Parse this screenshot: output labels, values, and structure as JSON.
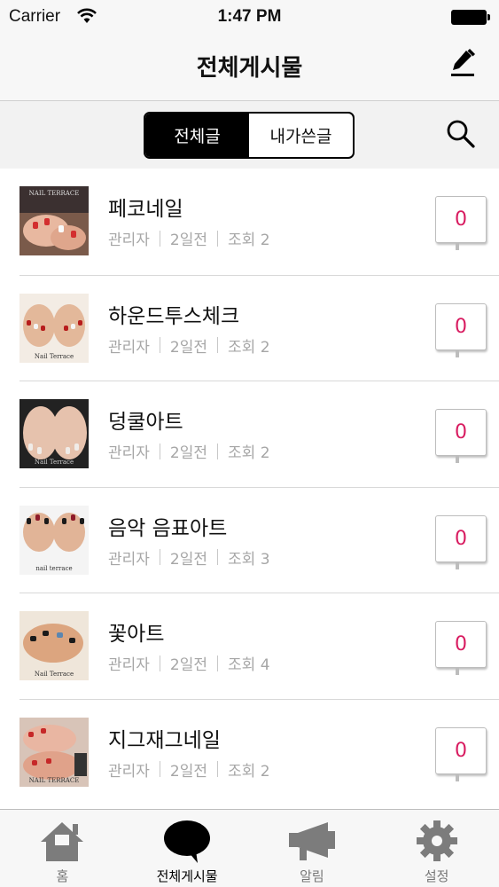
{
  "status_bar": {
    "carrier": "Carrier",
    "time": "1:47 PM"
  },
  "nav": {
    "title": "전체게시물",
    "edit_icon": "pencil-icon"
  },
  "segment": {
    "items": [
      "전체글",
      "내가쓴글"
    ],
    "selected": "전체글",
    "search_icon": "search-icon"
  },
  "posts": [
    {
      "title": "페코네일",
      "author": "관리자",
      "date": "2일전",
      "views": "조회 2",
      "comments": "0",
      "thumb_label": "NAIL TERRACE"
    },
    {
      "title": "하운드투스체크",
      "author": "관리자",
      "date": "2일전",
      "views": "조회 2",
      "comments": "0",
      "thumb_label": "Nail Terrace"
    },
    {
      "title": "덩쿨아트",
      "author": "관리자",
      "date": "2일전",
      "views": "조회 2",
      "comments": "0",
      "thumb_label": "Nail Terrace"
    },
    {
      "title": "음악 음표아트",
      "author": "관리자",
      "date": "2일전",
      "views": "조회 3",
      "comments": "0",
      "thumb_label": "nail terrace"
    },
    {
      "title": "꽃아트",
      "author": "관리자",
      "date": "2일전",
      "views": "조회 4",
      "comments": "0",
      "thumb_label": "Nail Terrace"
    },
    {
      "title": "지그재그네일",
      "author": "관리자",
      "date": "2일전",
      "views": "조회 2",
      "comments": "0",
      "thumb_label": "NAIL TERRACE"
    }
  ],
  "tabs": [
    {
      "label": "홈",
      "icon": "home-icon"
    },
    {
      "label": "전체게시물",
      "icon": "speech-bubble-icon",
      "active": true
    },
    {
      "label": "알림",
      "icon": "megaphone-icon"
    },
    {
      "label": "설정",
      "icon": "gear-icon"
    }
  ],
  "colors": {
    "comment_count": "#d81b60",
    "segment_active": "#000000"
  }
}
